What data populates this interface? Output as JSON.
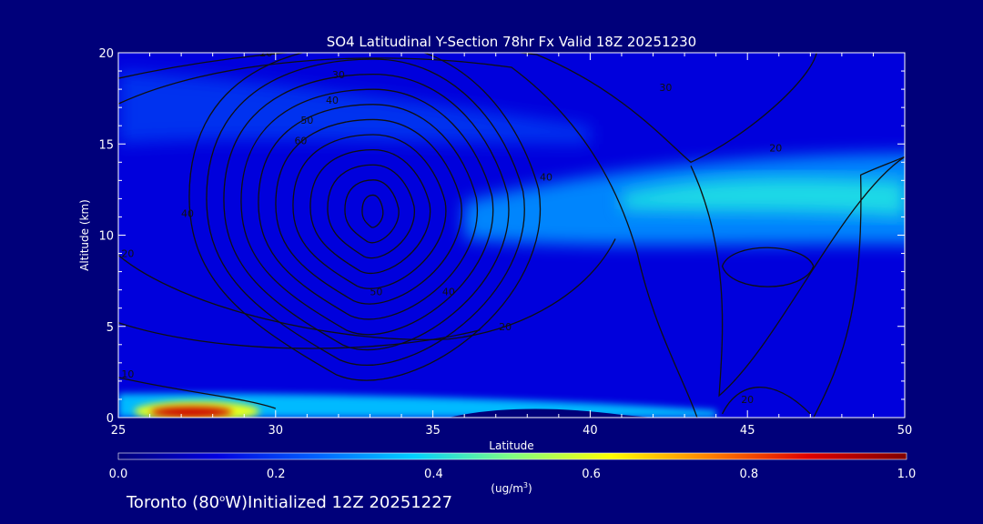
{
  "chart_data": {
    "type": "heatmap",
    "title": "SO4 Latitudinal Y-Section 78hr  Fx Valid 18Z 20251230",
    "xlabel": "Latitude",
    "ylabel": "Altitude (km)",
    "xlim": [
      25,
      50
    ],
    "ylim": [
      0,
      20
    ],
    "x_ticks": [
      25,
      30,
      35,
      40,
      45,
      50
    ],
    "y_ticks": [
      0,
      5,
      10,
      15,
      20
    ],
    "colorbar": {
      "range": [
        0.0,
        1.0
      ],
      "ticks": [
        "0.0",
        "0.2",
        "0.4",
        "0.6",
        "0.8",
        "1.0"
      ],
      "unit_label": "(ug/m",
      "unit_sup": "3",
      "unit_close": ")",
      "colors": [
        "#00007a",
        "#0000e0",
        "#0060ff",
        "#00d0ff",
        "#80ff80",
        "#ffff00",
        "#ff8000",
        "#e00000",
        "#800000"
      ]
    },
    "field": {
      "background": 0.12,
      "bands": [
        {
          "name": "upper-layer",
          "y_range": [
            9.5,
            14.5
          ],
          "from_lat": 36,
          "to_lat": 50,
          "peak": 0.4
        },
        {
          "name": "surface-layer",
          "y_range": [
            0,
            1.3
          ],
          "from_lat": 25,
          "to_lat": 44,
          "peak": 0.35
        },
        {
          "name": "surface-max",
          "x_range": [
            25.5,
            29.5
          ],
          "y_range": [
            0,
            0.8
          ],
          "peak": 0.9
        },
        {
          "name": "top-layer",
          "y_range": [
            15,
            19
          ],
          "from_lat": 25,
          "to_lat": 40,
          "peak": 0.2
        }
      ]
    },
    "contour_labels": [
      {
        "text": "20",
        "lat": 29.7,
        "alt": 19.8
      },
      {
        "text": "30",
        "lat": 32.0,
        "alt": 18.6
      },
      {
        "text": "40",
        "lat": 31.8,
        "alt": 17.2
      },
      {
        "text": "50",
        "lat": 31.0,
        "alt": 16.1
      },
      {
        "text": "60",
        "lat": 30.8,
        "alt": 15.0
      },
      {
        "text": "30",
        "lat": 42.4,
        "alt": 17.9
      },
      {
        "text": "40",
        "lat": 38.6,
        "alt": 13.0
      },
      {
        "text": "20",
        "lat": 45.9,
        "alt": 14.6
      },
      {
        "text": "40",
        "lat": 27.2,
        "alt": 11.0
      },
      {
        "text": "50",
        "lat": 33.2,
        "alt": 6.7
      },
      {
        "text": "40",
        "lat": 35.5,
        "alt": 6.7
      },
      {
        "text": "20",
        "lat": 37.3,
        "alt": 4.8
      },
      {
        "text": "20",
        "lat": 25.3,
        "alt": 8.8
      },
      {
        "text": "10",
        "lat": 25.3,
        "alt": 2.2
      },
      {
        "text": "20",
        "lat": 45.0,
        "alt": 0.8
      }
    ]
  },
  "footer": {
    "location": "Toronto (80",
    "degree": "o",
    "rest": "W)Initialized 12Z 20251227"
  }
}
